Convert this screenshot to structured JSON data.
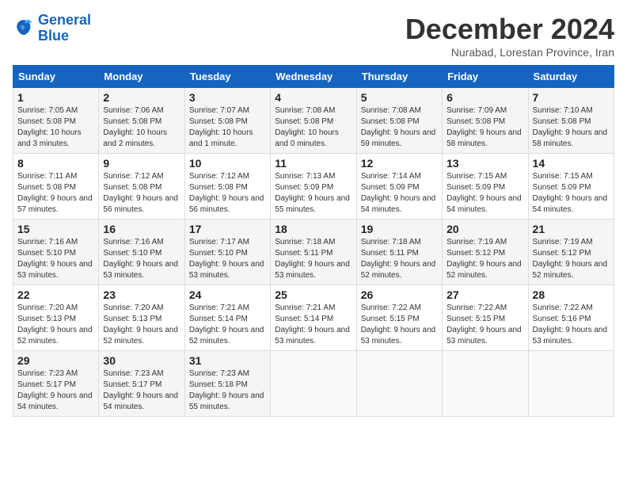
{
  "logo": {
    "line1": "General",
    "line2": "Blue"
  },
  "header": {
    "month": "December 2024",
    "location": "Nurabad, Lorestan Province, Iran"
  },
  "weekdays": [
    "Sunday",
    "Monday",
    "Tuesday",
    "Wednesday",
    "Thursday",
    "Friday",
    "Saturday"
  ],
  "weeks": [
    [
      {
        "day": "1",
        "rise": "Sunrise: 7:05 AM",
        "set": "Sunset: 5:08 PM",
        "daylight": "Daylight: 10 hours and 3 minutes."
      },
      {
        "day": "2",
        "rise": "Sunrise: 7:06 AM",
        "set": "Sunset: 5:08 PM",
        "daylight": "Daylight: 10 hours and 2 minutes."
      },
      {
        "day": "3",
        "rise": "Sunrise: 7:07 AM",
        "set": "Sunset: 5:08 PM",
        "daylight": "Daylight: 10 hours and 1 minute."
      },
      {
        "day": "4",
        "rise": "Sunrise: 7:08 AM",
        "set": "Sunset: 5:08 PM",
        "daylight": "Daylight: 10 hours and 0 minutes."
      },
      {
        "day": "5",
        "rise": "Sunrise: 7:08 AM",
        "set": "Sunset: 5:08 PM",
        "daylight": "Daylight: 9 hours and 59 minutes."
      },
      {
        "day": "6",
        "rise": "Sunrise: 7:09 AM",
        "set": "Sunset: 5:08 PM",
        "daylight": "Daylight: 9 hours and 58 minutes."
      },
      {
        "day": "7",
        "rise": "Sunrise: 7:10 AM",
        "set": "Sunset: 5:08 PM",
        "daylight": "Daylight: 9 hours and 58 minutes."
      }
    ],
    [
      {
        "day": "8",
        "rise": "Sunrise: 7:11 AM",
        "set": "Sunset: 5:08 PM",
        "daylight": "Daylight: 9 hours and 57 minutes."
      },
      {
        "day": "9",
        "rise": "Sunrise: 7:12 AM",
        "set": "Sunset: 5:08 PM",
        "daylight": "Daylight: 9 hours and 56 minutes."
      },
      {
        "day": "10",
        "rise": "Sunrise: 7:12 AM",
        "set": "Sunset: 5:08 PM",
        "daylight": "Daylight: 9 hours and 56 minutes."
      },
      {
        "day": "11",
        "rise": "Sunrise: 7:13 AM",
        "set": "Sunset: 5:09 PM",
        "daylight": "Daylight: 9 hours and 55 minutes."
      },
      {
        "day": "12",
        "rise": "Sunrise: 7:14 AM",
        "set": "Sunset: 5:09 PM",
        "daylight": "Daylight: 9 hours and 54 minutes."
      },
      {
        "day": "13",
        "rise": "Sunrise: 7:15 AM",
        "set": "Sunset: 5:09 PM",
        "daylight": "Daylight: 9 hours and 54 minutes."
      },
      {
        "day": "14",
        "rise": "Sunrise: 7:15 AM",
        "set": "Sunset: 5:09 PM",
        "daylight": "Daylight: 9 hours and 54 minutes."
      }
    ],
    [
      {
        "day": "15",
        "rise": "Sunrise: 7:16 AM",
        "set": "Sunset: 5:10 PM",
        "daylight": "Daylight: 9 hours and 53 minutes."
      },
      {
        "day": "16",
        "rise": "Sunrise: 7:16 AM",
        "set": "Sunset: 5:10 PM",
        "daylight": "Daylight: 9 hours and 53 minutes."
      },
      {
        "day": "17",
        "rise": "Sunrise: 7:17 AM",
        "set": "Sunset: 5:10 PM",
        "daylight": "Daylight: 9 hours and 53 minutes."
      },
      {
        "day": "18",
        "rise": "Sunrise: 7:18 AM",
        "set": "Sunset: 5:11 PM",
        "daylight": "Daylight: 9 hours and 53 minutes."
      },
      {
        "day": "19",
        "rise": "Sunrise: 7:18 AM",
        "set": "Sunset: 5:11 PM",
        "daylight": "Daylight: 9 hours and 52 minutes."
      },
      {
        "day": "20",
        "rise": "Sunrise: 7:19 AM",
        "set": "Sunset: 5:12 PM",
        "daylight": "Daylight: 9 hours and 52 minutes."
      },
      {
        "day": "21",
        "rise": "Sunrise: 7:19 AM",
        "set": "Sunset: 5:12 PM",
        "daylight": "Daylight: 9 hours and 52 minutes."
      }
    ],
    [
      {
        "day": "22",
        "rise": "Sunrise: 7:20 AM",
        "set": "Sunset: 5:13 PM",
        "daylight": "Daylight: 9 hours and 52 minutes."
      },
      {
        "day": "23",
        "rise": "Sunrise: 7:20 AM",
        "set": "Sunset: 5:13 PM",
        "daylight": "Daylight: 9 hours and 52 minutes."
      },
      {
        "day": "24",
        "rise": "Sunrise: 7:21 AM",
        "set": "Sunset: 5:14 PM",
        "daylight": "Daylight: 9 hours and 52 minutes."
      },
      {
        "day": "25",
        "rise": "Sunrise: 7:21 AM",
        "set": "Sunset: 5:14 PM",
        "daylight": "Daylight: 9 hours and 53 minutes."
      },
      {
        "day": "26",
        "rise": "Sunrise: 7:22 AM",
        "set": "Sunset: 5:15 PM",
        "daylight": "Daylight: 9 hours and 53 minutes."
      },
      {
        "day": "27",
        "rise": "Sunrise: 7:22 AM",
        "set": "Sunset: 5:15 PM",
        "daylight": "Daylight: 9 hours and 53 minutes."
      },
      {
        "day": "28",
        "rise": "Sunrise: 7:22 AM",
        "set": "Sunset: 5:16 PM",
        "daylight": "Daylight: 9 hours and 53 minutes."
      }
    ],
    [
      {
        "day": "29",
        "rise": "Sunrise: 7:23 AM",
        "set": "Sunset: 5:17 PM",
        "daylight": "Daylight: 9 hours and 54 minutes."
      },
      {
        "day": "30",
        "rise": "Sunrise: 7:23 AM",
        "set": "Sunset: 5:17 PM",
        "daylight": "Daylight: 9 hours and 54 minutes."
      },
      {
        "day": "31",
        "rise": "Sunrise: 7:23 AM",
        "set": "Sunset: 5:18 PM",
        "daylight": "Daylight: 9 hours and 55 minutes."
      },
      null,
      null,
      null,
      null
    ]
  ]
}
